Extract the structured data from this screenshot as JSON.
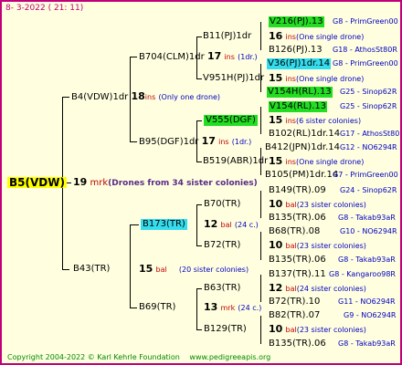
{
  "date": "8-  3-2022 ( 21: 11)",
  "queen": {
    "name": "B5(VDW)",
    "count": "19",
    "unit": "mrk",
    "note": "(Drones from 34 sister colonies)"
  },
  "gen1": [
    {
      "name": "B4(VDW)1dr",
      "count": "18",
      "unit": "ins",
      "note": "(Only one drone)"
    },
    {
      "name": "B43(TR)",
      "count": "15",
      "unit": "bal",
      "note": "(20 sister colonies)"
    }
  ],
  "gen2": [
    {
      "name": "B704(CLM)1dr",
      "count": "17",
      "unit": "ins",
      "note": "(1dr.)"
    },
    {
      "name": "B95(DGF)1dr",
      "count": "17",
      "unit": "ins",
      "note": "(1dr.)"
    },
    {
      "name": "B173(TR)",
      "count": "12",
      "unit": "bal",
      "note": "(24 c.)"
    },
    {
      "name": "B69(TR)",
      "count": "13",
      "unit": "mrk",
      "note": "(24 c.)"
    }
  ],
  "gen3": [
    {
      "name": "B11(PJ)1dr",
      "count": "16",
      "unit": "ins",
      "note": "(One single drone)"
    },
    {
      "name": "V951H(PJ)1dr",
      "count": "15",
      "unit": "ins",
      "note": "(One single drone)"
    },
    {
      "name": "V555(DGF)",
      "count": "15",
      "unit": "ins",
      "note": "(6 sister colonies)"
    },
    {
      "name": "B519(ABR)1dr",
      "count": "15",
      "unit": "ins",
      "note": "(One single drone)"
    },
    {
      "name": "B70(TR)",
      "count": "10",
      "unit": "bal",
      "note": "(23 sister colonies)"
    },
    {
      "name": "B72(TR)",
      "count": "10",
      "unit": "bal",
      "note": "(23 sister colonies)"
    },
    {
      "name": "B63(TR)",
      "count": "12",
      "unit": "bal",
      "note": "(24 sister colonies)"
    },
    {
      "name": "B129(TR)",
      "count": "10",
      "unit": "bal",
      "note": "(23 sister colonies)"
    }
  ],
  "gen4": [
    {
      "name": "V216(PJ).13",
      "breeder": "G8 - PrimGreen00"
    },
    {
      "name": "B126(PJ).13",
      "breeder": "G18 - AthosSt80R"
    },
    {
      "name": "V36(PJ)1dr.14",
      "breeder": "G8 - PrimGreen00"
    },
    {
      "name": "V154H(RL).13",
      "breeder": "G25 - Sinop62R"
    },
    {
      "name": "V154(RL).13",
      "breeder": "G25 - Sinop62R"
    },
    {
      "name": "B102(RL)1dr.14",
      "breeder": "G17 - AthosSt80R"
    },
    {
      "name": "B412(JPN)1dr.14",
      "breeder": "G12 - NO6294R"
    },
    {
      "name": "B105(PM)1dr.14",
      "breeder": "G7 - PrimGreen00"
    },
    {
      "name": "B149(TR).09",
      "breeder": "G24 - Sinop62R"
    },
    {
      "name": "B135(TR).06",
      "breeder": "G8 - Takab93aR"
    },
    {
      "name": "B68(TR).08",
      "breeder": "G10 - NO6294R"
    },
    {
      "name": "B135(TR).06",
      "breeder": "G8 - Takab93aR"
    },
    {
      "name": "B137(TR).11",
      "breeder": "G8 - Kangaroo98R"
    },
    {
      "name": "B72(TR).10",
      "breeder": "G11 - NO6294R"
    },
    {
      "name": "B82(TR).07",
      "breeder": "G9 - NO6294R"
    },
    {
      "name": "B135(TR).06",
      "breeder": "G8 - Takab93aR"
    }
  ],
  "footer": {
    "copyright": "Copyright 2004-2022 © Karl Kehrle Foundation",
    "site": "www.pedigreeapis.org"
  }
}
